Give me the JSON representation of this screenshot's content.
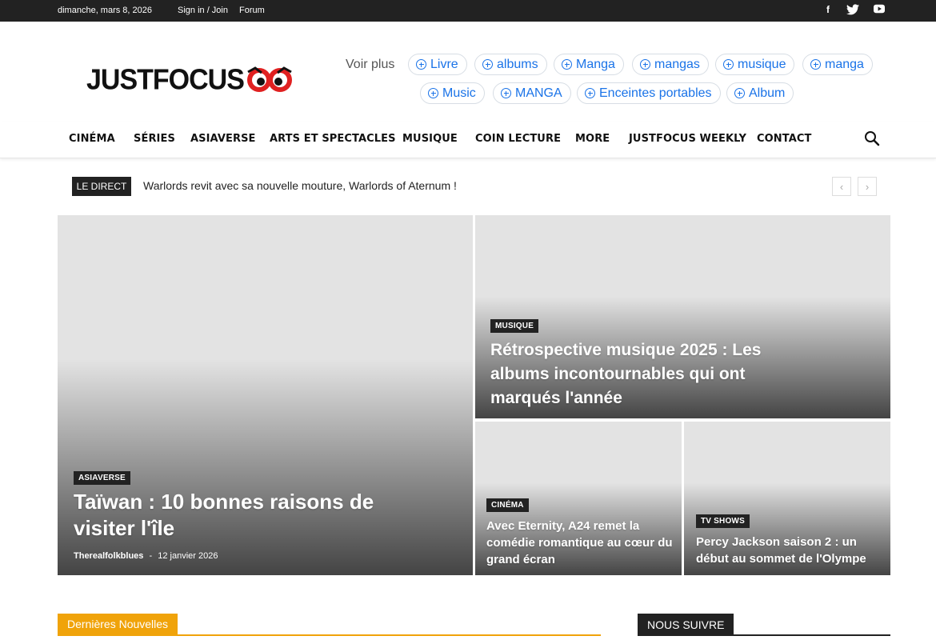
{
  "topbar": {
    "date": "dimanche, mars 8, 2026",
    "signin": "Sign in / Join",
    "forum": "Forum",
    "social": [
      {
        "icon": "facebook-icon",
        "glyph": "f"
      },
      {
        "icon": "twitter-icon",
        "glyph": "t"
      },
      {
        "icon": "youtube-icon",
        "glyph": "▶"
      }
    ]
  },
  "logo": {
    "text": "JUSTFOCUS"
  },
  "voir_plus": {
    "label": "Voir plus",
    "tags": [
      "Livre",
      "albums",
      "Manga",
      "mangas",
      "musique",
      "manga",
      "Music",
      "MANGA",
      "Enceintes portables",
      "Album"
    ]
  },
  "nav": {
    "items": [
      "CINÉMA",
      "SÉRIES",
      "ASIAVERSE",
      "ARTS ET SPECTACLES",
      "MUSIQUE",
      "COIN LECTURE",
      "MORE",
      "JUSTFOCUS WEEKLY",
      "CONTACT"
    ]
  },
  "ticker": {
    "label": "LE DIRECT",
    "text": "Warlords revit avec sa nouvelle mouture, Warlords of Aternum !",
    "prev": "‹",
    "next": "›"
  },
  "hero": {
    "main": {
      "category": "ASIAVERSE",
      "title": "Taïwan : 10 bonnes raisons de visiter l'île",
      "author": "Therealfolkblues",
      "sep": "-",
      "date": "12 janvier 2026"
    },
    "top_right": {
      "category": "MUSIQUE",
      "title": "Rétrospective musique 2025 : Les albums incontournables qui ont marqués l'année"
    },
    "bottom_left": {
      "category": "CINÉMA",
      "title": "Avec Eternity, A24 remet la comédie romantique au cœur du grand écran"
    },
    "bottom_right": {
      "category": "TV SHOWS",
      "title": "Percy Jackson saison 2 : un début au sommet de l'Olympe"
    }
  },
  "sections": {
    "latest": "Dernières Nouvelles",
    "follow": "NOUS SUIVRE"
  },
  "colors": {
    "accent_orange": "#f0a30a",
    "link_blue": "#1a73e8",
    "dark": "#222222",
    "logo_red": "#e02020"
  }
}
